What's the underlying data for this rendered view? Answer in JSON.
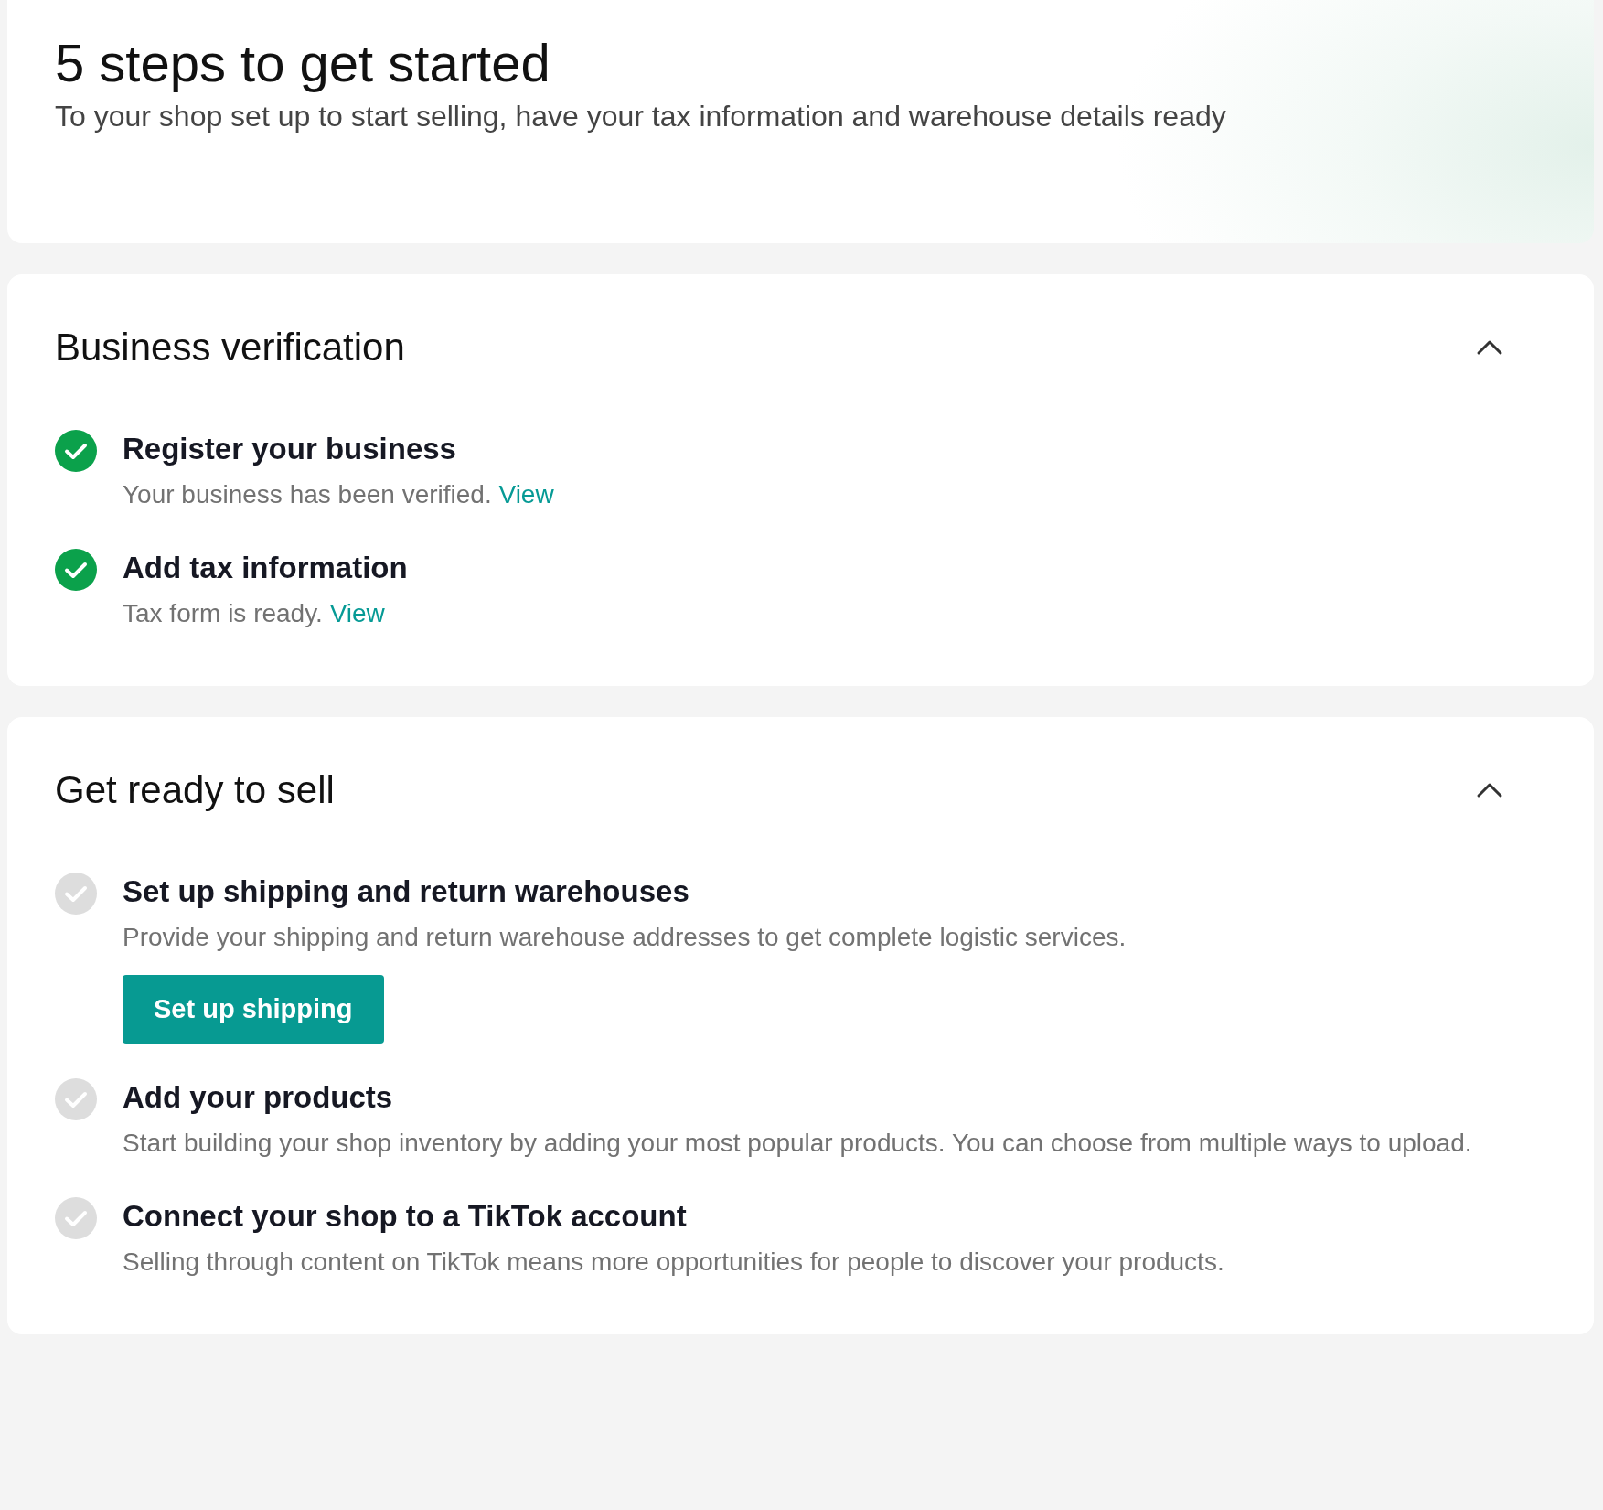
{
  "header": {
    "title": "5 steps to get started",
    "subtitle": "To your shop set up to start selling, have your tax information and warehouse details ready"
  },
  "sections": [
    {
      "title": "Business verification",
      "expanded": true,
      "steps": [
        {
          "title": "Register your business",
          "done": true,
          "description": "Your business has been verified.",
          "link": "View"
        },
        {
          "title": "Add tax information",
          "done": true,
          "description": "Tax form is ready.",
          "link": "View"
        }
      ]
    },
    {
      "title": "Get ready to sell",
      "expanded": true,
      "steps": [
        {
          "title": "Set up shipping and return warehouses",
          "done": false,
          "description": "Provide your shipping and return warehouse addresses to get complete logistic services.",
          "button": "Set up shipping"
        },
        {
          "title": "Add your products",
          "done": false,
          "description": "Start building your shop inventory by adding your most popular products. You can choose from multiple ways to upload."
        },
        {
          "title": "Connect your shop to a TikTok account",
          "done": false,
          "description": "Selling through content on TikTok means more opportunities for people to discover your products."
        }
      ]
    }
  ]
}
